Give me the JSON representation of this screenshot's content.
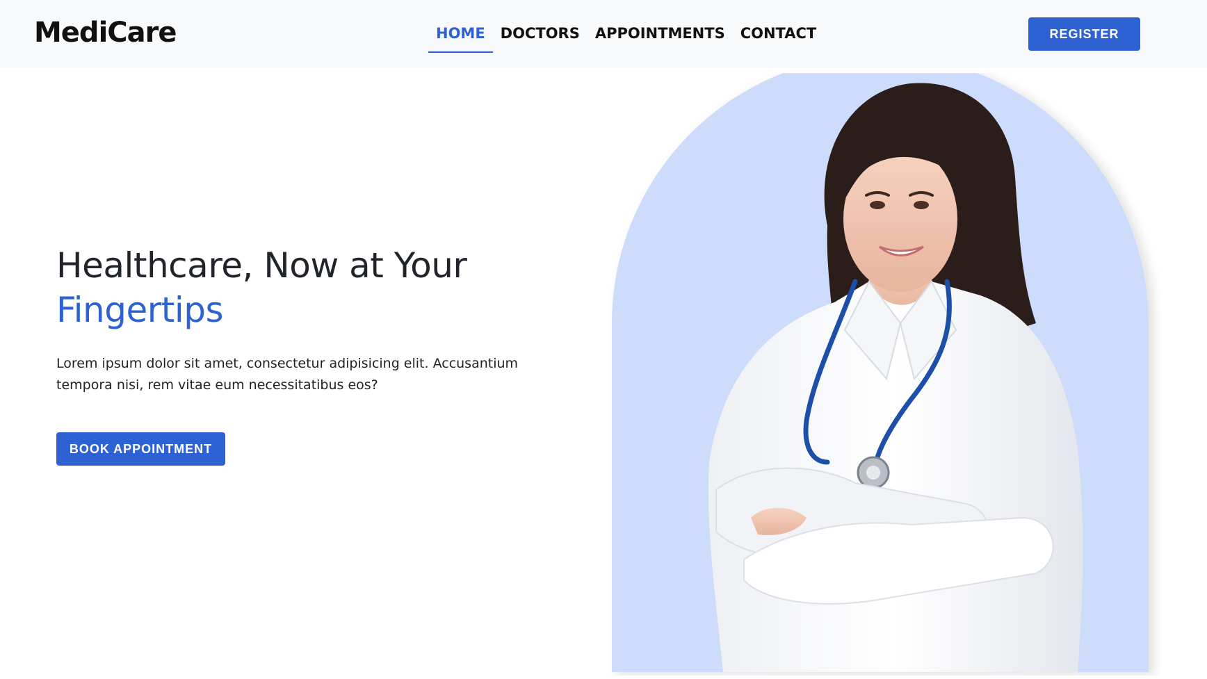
{
  "brand": {
    "name": "MediCare"
  },
  "nav": {
    "items": [
      {
        "label": "HOME",
        "active": true
      },
      {
        "label": "DOCTORS",
        "active": false
      },
      {
        "label": "APPOINTMENTS",
        "active": false
      },
      {
        "label": "CONTACT",
        "active": false
      }
    ]
  },
  "header": {
    "register_label": "REGISTER"
  },
  "hero": {
    "title_line1": "Healthcare, Now at Your",
    "title_line2": "Fingertips",
    "description": "Lorem ipsum dolor sit amet, consectetur adipisicing elit. Accusantium tempora nisi, rem vitae eum necessitatibus eos?",
    "cta_label": "BOOK APPOINTMENT"
  },
  "colors": {
    "accent": "#2e62d3",
    "navbar_bg": "#f8f9fa",
    "arch_bg": "#cddcfb",
    "text": "#212529"
  }
}
